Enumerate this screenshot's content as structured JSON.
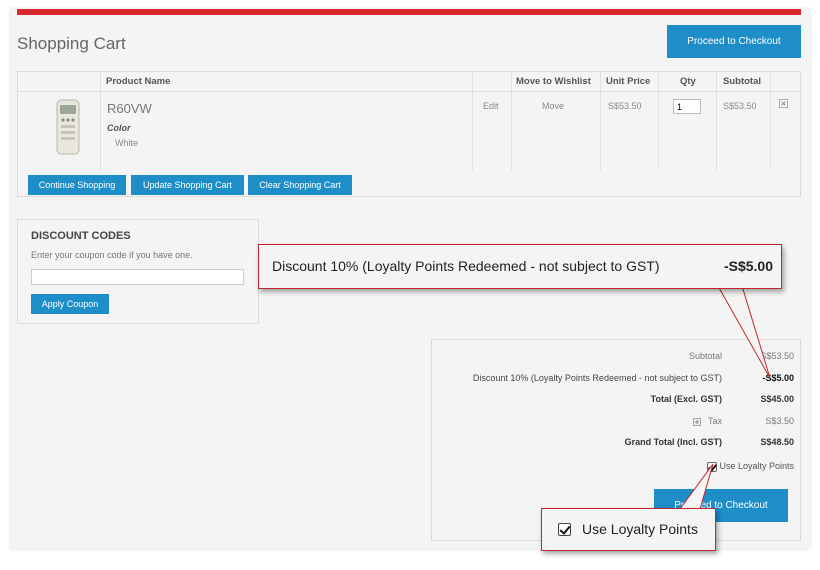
{
  "page": {
    "title": "Shopping Cart"
  },
  "buttons": {
    "proceed_checkout": "Proceed to Checkout",
    "continue_shopping": "Continue Shopping",
    "update_cart": "Update Shopping Cart",
    "clear_cart": "Clear Shopping Cart",
    "apply_coupon": "Apply Coupon",
    "proceed_checkout_bottom": "Proceed to Checkout"
  },
  "cart": {
    "headers": [
      "Product Name",
      "Move to Wishlist",
      "Unit Price",
      "Qty",
      "Subtotal"
    ],
    "items": [
      {
        "name": "R60VW",
        "option_label": "Color",
        "option_value": "White",
        "edit": "Edit",
        "move": "Move",
        "unit_price": "S$53.50",
        "qty": "1",
        "subtotal": "S$53.50"
      }
    ]
  },
  "discount": {
    "title": "DISCOUNT CODES",
    "instruction": "Enter your coupon code if you have one.",
    "input_value": ""
  },
  "totals": {
    "subtotal_label": "Subtotal",
    "subtotal_value": "S$53.50",
    "discount_label": "Discount 10% (Loyalty Points Redeemed - not subject to GST)",
    "discount_value": "-S$5.00",
    "total_excl_label": "Total (Excl. GST)",
    "total_excl_value": "S$45.00",
    "tax_label": "Tax",
    "tax_value": "S$3.50",
    "grand_total_label": "Grand Total (Incl. GST)",
    "grand_total_value": "S$48.50",
    "loyalty_label": "Use Loyalty Points",
    "loyalty_checked": true
  },
  "callouts": {
    "discount_label": "Discount 10% (Loyalty Points Redeemed - not subject to GST)",
    "discount_value": "-S$5.00",
    "loyalty_label": "Use Loyalty Points"
  },
  "colors": {
    "accent_red": "#d9262a",
    "button_blue": "#1e8ec8",
    "callout_border": "#c0282d"
  },
  "icons": {
    "remove": "close-icon",
    "tax_toggle": "expand-icon",
    "checkbox": "checkbox-checked-icon"
  }
}
